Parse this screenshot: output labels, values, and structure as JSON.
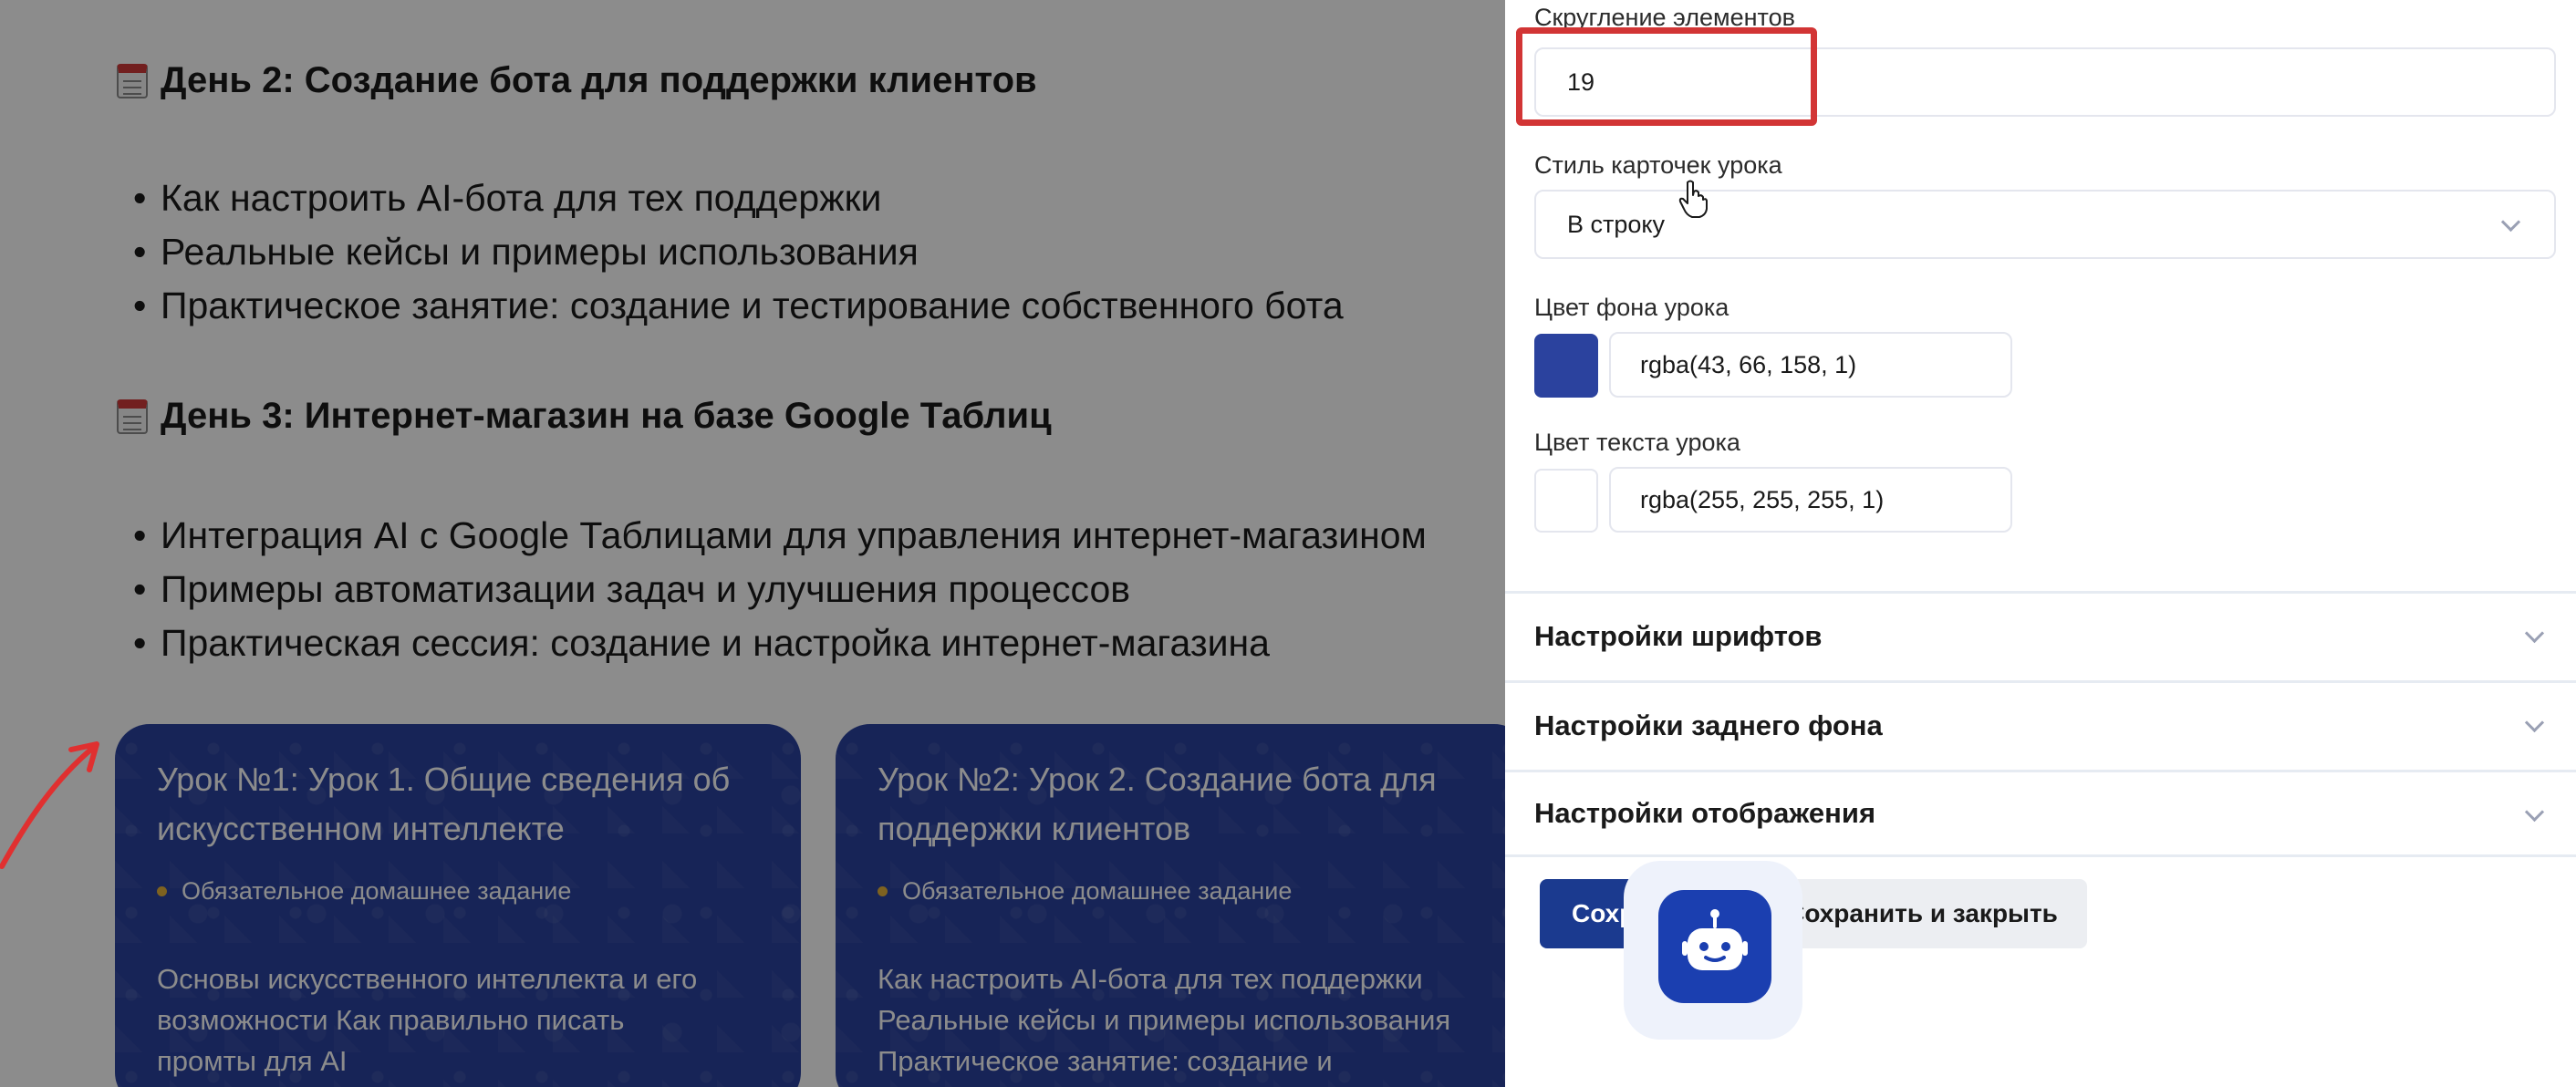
{
  "preview": {
    "days": [
      {
        "title": "День 2: Создание бота для поддержки клиентов",
        "bullets": [
          "Как настроить AI-бота для тех поддержки",
          "Реальные кейсы и примеры использования",
          "Практическое занятие: создание и тестирование собственного бота"
        ]
      },
      {
        "title": "День 3: Интернет-магазин на базе Google Таблиц",
        "bullets": [
          "Интеграция AI с Google Таблицами для управления интернет-магазином",
          "Примеры автоматизации задач и улучшения процессов",
          "Практическая сессия: создание и настройка интернет-магазина"
        ]
      }
    ],
    "lessons": [
      {
        "title_line1": "Урок №1: Урок 1. Общие сведения об",
        "title_line2": "искусственном интеллекте",
        "homework": "Обязательное домашнее задание",
        "desc_line1": "Основы искусственного интеллекта и его",
        "desc_line2": "возможности Как правильно писать",
        "desc_line3": "промты для AI"
      },
      {
        "title_line1": "Урок №2: Урок 2. Создание бота для",
        "title_line2": "поддержки клиентов",
        "homework": "Обязательное домашнее задание",
        "desc_line1": "Как настроить AI-бота для тех поддержки",
        "desc_line2": "Реальные кейсы и примеры использования",
        "desc_line3": "Практическое занятие: создание и"
      }
    ]
  },
  "panel": {
    "rounding": {
      "label": "Скругление элементов",
      "value": "19"
    },
    "card_style": {
      "label": "Стиль карточек урока",
      "value": "В строку"
    },
    "bg_color": {
      "label": "Цвет фона урока",
      "value": "rgba(43, 66, 158, 1)",
      "swatch": "#2b429e"
    },
    "text_color": {
      "label": "Цвет текста урока",
      "value": "rgba(255, 255, 255, 1)",
      "swatch": "#ffffff"
    },
    "sections": [
      "Настройки шрифтов",
      "Настройки заднего фона",
      "Настройки отображения"
    ],
    "save_label": "Сохранить",
    "save_close_label": "Сохранить и закрыть"
  },
  "colors": {
    "accent": "#1b3a8f",
    "highlight": "#d23535",
    "overlay": "rgba(0,0,0,0.45)"
  },
  "icons": [
    "calendar-icon",
    "chevron-down-icon",
    "hand-cursor-icon",
    "robot-icon",
    "arrow-annotation-icon"
  ]
}
